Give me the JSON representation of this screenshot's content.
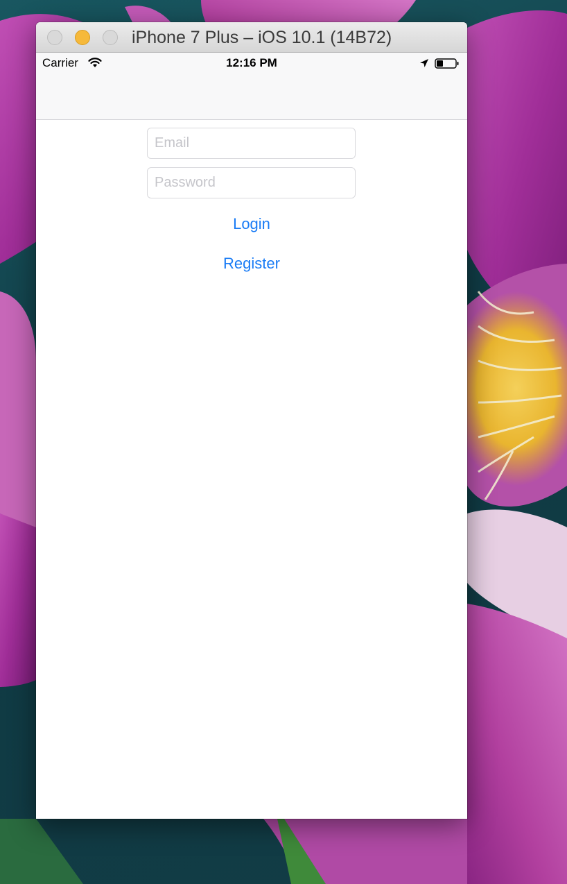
{
  "window": {
    "title": "iPhone 7 Plus – iOS 10.1 (14B72)",
    "accent_minimize": "#f6b93b"
  },
  "status_bar": {
    "carrier": "Carrier",
    "time": "12:16 PM",
    "icons": [
      "wifi-icon",
      "location-icon",
      "battery-icon"
    ]
  },
  "login_form": {
    "email": {
      "value": "",
      "placeholder": "Email"
    },
    "password": {
      "value": "",
      "placeholder": "Password"
    },
    "login_label": "Login",
    "register_label": "Register",
    "link_color": "#1a7cf5"
  }
}
